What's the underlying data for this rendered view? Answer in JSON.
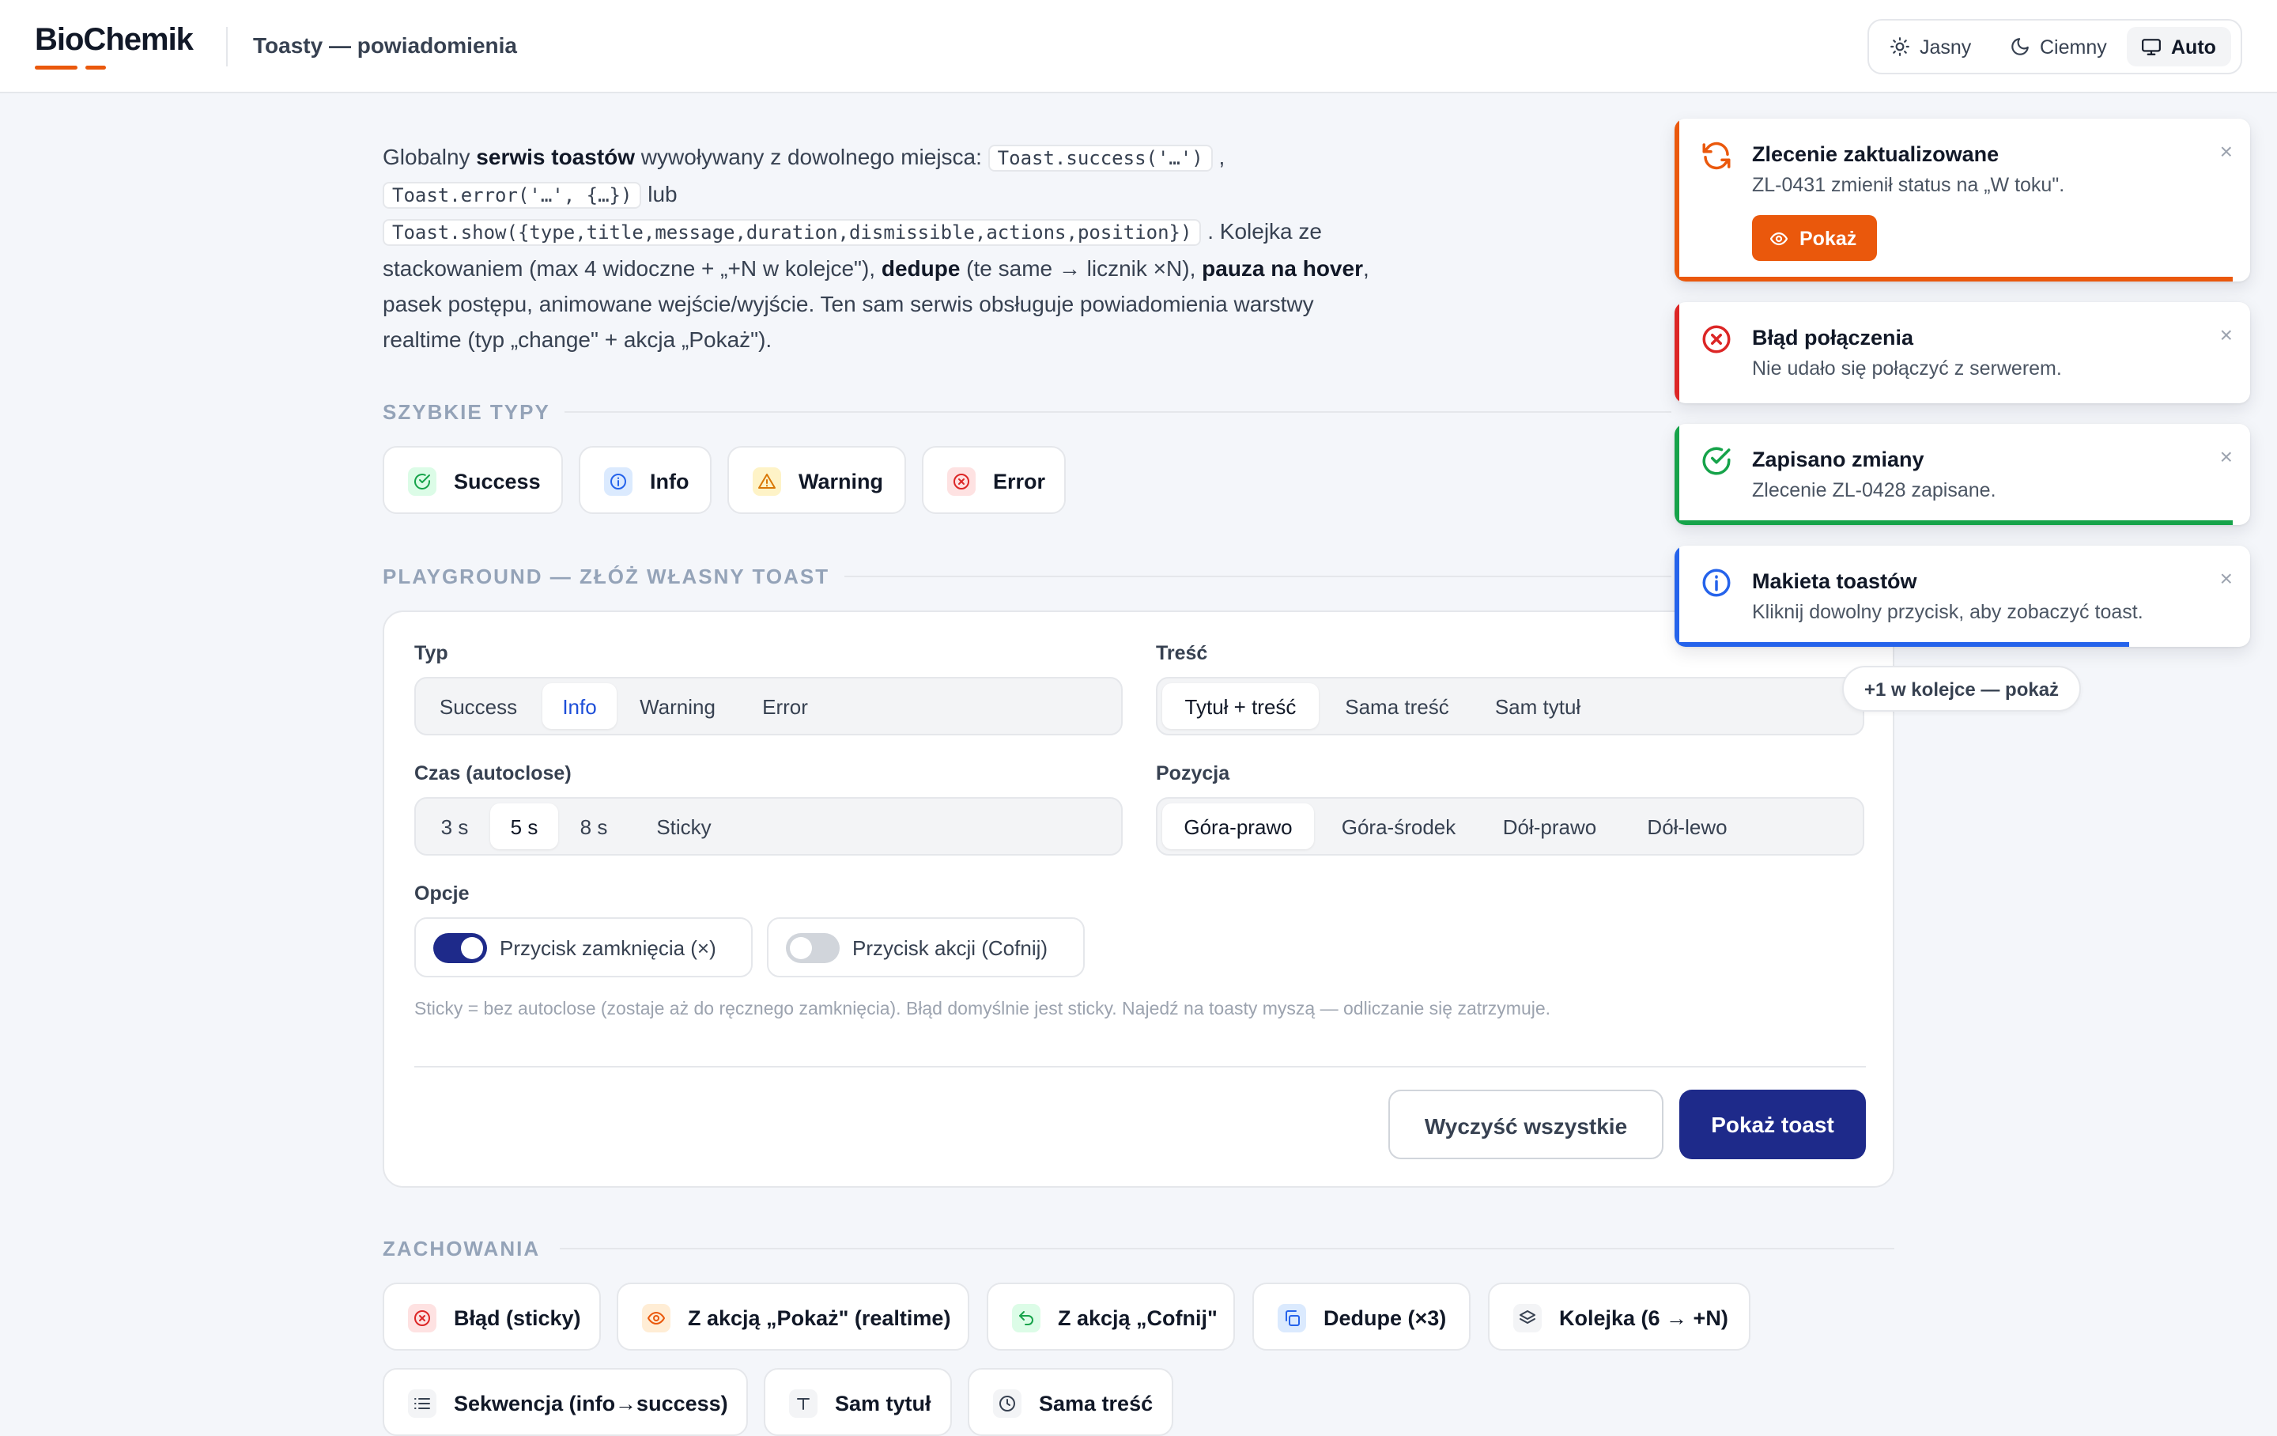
{
  "header": {
    "logo": "BioChemik",
    "page_title": "Toasty — powiadomienia",
    "theme": {
      "light": "Jasny",
      "dark": "Ciemny",
      "auto": "Auto",
      "selected": "Auto"
    }
  },
  "intro": {
    "t1": "Globalny ",
    "b1": "serwis toastów",
    "t2": " wywoływany z dowolnego miejsca: ",
    "c1": "Toast.success('…')",
    "t3": " ,",
    "c2": "Toast.error('…', {…})",
    "t4": " lub",
    "c3": "Toast.show({type,title,message,duration,dismissible,actions,position})",
    "t5": " . Kolejka ze stackowaniem (max 4 widoczne + „+N w kolejce\"), ",
    "b2": "dedupe",
    "t6": " (te same → licznik ×N), ",
    "b3": "pauza na hover",
    "t7": ", pasek postępu, animowane wejście/wyjście. Ten sam serwis obsługuje powiadomienia warstwy realtime (typ „change\" + akcja „Pokaż\")."
  },
  "quick": {
    "heading": "SZYBKIE TYPY",
    "buttons": [
      "Success",
      "Info",
      "Warning",
      "Error"
    ]
  },
  "playground": {
    "heading": "PLAYGROUND — ZŁÓŻ WŁASNY TOAST",
    "type": {
      "label": "Typ",
      "options": [
        "Success",
        "Info",
        "Warning",
        "Error"
      ],
      "selected": "Info"
    },
    "content": {
      "label": "Treść",
      "options": [
        "Tytuł + treść",
        "Sama treść",
        "Sam tytuł"
      ],
      "selected": "Tytuł + treść"
    },
    "duration": {
      "label": "Czas (autoclose)",
      "options": [
        "3 s",
        "5 s",
        "8 s",
        "Sticky"
      ],
      "selected": "5 s"
    },
    "position": {
      "label": "Pozycja",
      "options": [
        "Góra-prawo",
        "Góra-środek",
        "Dół-prawo",
        "Dół-lewo"
      ],
      "selected": "Góra-prawo"
    },
    "options": {
      "label": "Opcje",
      "close_button": {
        "label": "Przycisk zamknięcia (×)",
        "on": true
      },
      "action_button": {
        "label": "Przycisk akcji (Cofnij)",
        "on": false
      }
    },
    "hint": "Sticky = bez autoclose (zostaje aż do ręcznego zamknięcia). Błąd domyślnie jest sticky. Najedź na toasty myszą — odliczanie się zatrzymuje.",
    "clear_label": "Wyczyść wszystkie",
    "show_label": "Pokaż toast"
  },
  "behaviors": {
    "heading": "ZACHOWANIA",
    "buttons": [
      "Błąd (sticky)",
      "Z akcją „Pokaż\" (realtime)",
      "Z akcją „Cofnij\"",
      "Dedupe (×3)",
      "Kolejka (6 → +N)",
      "Sekwencja (info→success)",
      "Sam tytuł",
      "Sama treść"
    ]
  },
  "toasts": [
    {
      "type": "change",
      "icon": "refresh-icon",
      "color": "#ea580c",
      "title": "Zlecenie zaktualizowane",
      "message": "ZL-0431 zmienił status na „W toku\".",
      "action": "Pokaż",
      "progress": 0.97
    },
    {
      "type": "error",
      "icon": "x-circle-icon",
      "color": "#dc2626",
      "title": "Błąd połączenia",
      "message": "Nie udało się połączyć z serwerem.",
      "progress": 0
    },
    {
      "type": "success",
      "icon": "check-circle-icon",
      "color": "#16a34a",
      "title": "Zapisano zmiany",
      "message": "Zlecenie ZL-0428 zapisane.",
      "progress": 0.97
    },
    {
      "type": "info",
      "icon": "info-icon",
      "color": "#2563eb",
      "title": "Makieta toastów",
      "message": "Kliknij dowolny przycisk, aby zobaczyć toast.",
      "progress": 0.79
    }
  ],
  "queue_chip": "+1 w kolejce — pokaż",
  "colors": {
    "brand": "#ea580c",
    "primary": "#1e2a8a",
    "success": "#16a34a",
    "info": "#2563eb",
    "warning": "#d97706",
    "error": "#dc2626"
  }
}
